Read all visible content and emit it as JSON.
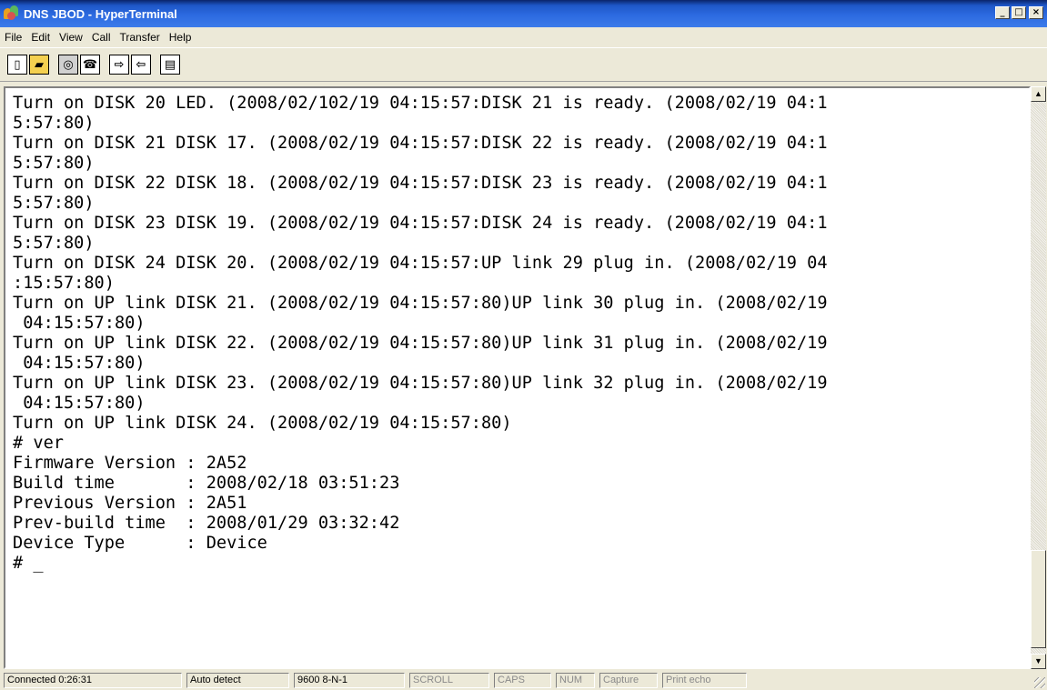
{
  "window": {
    "title": "DNS JBOD - HyperTerminal",
    "minimize_glyph": "_",
    "maximize_glyph": "□",
    "close_glyph": "×"
  },
  "menu": [
    {
      "label": "File"
    },
    {
      "label": "Edit"
    },
    {
      "label": "View"
    },
    {
      "label": "Call"
    },
    {
      "label": "Transfer"
    },
    {
      "label": "Help"
    }
  ],
  "toolbar": {
    "buttons": [
      {
        "icon": "new-connection-icon",
        "glyph": "▯"
      },
      {
        "icon": "open-folder-icon",
        "glyph": "▰"
      },
      {
        "icon": "disconnect-icon",
        "glyph": "◎"
      },
      {
        "icon": "dial-icon",
        "glyph": "☎"
      },
      {
        "icon": "send-file-icon",
        "glyph": "⇨"
      },
      {
        "icon": "receive-file-icon",
        "glyph": "⇦"
      },
      {
        "icon": "properties-icon",
        "glyph": "▤"
      }
    ]
  },
  "terminal": {
    "lines": [
      "Turn on DISK 20 LED. (2008/02/102/19 04:15:57:DISK 21 is ready. (2008/02/19 04:1",
      "5:57:80)",
      "Turn on DISK 21 DISK 17. (2008/02/19 04:15:57:DISK 22 is ready. (2008/02/19 04:1",
      "5:57:80)",
      "Turn on DISK 22 DISK 18. (2008/02/19 04:15:57:DISK 23 is ready. (2008/02/19 04:1",
      "5:57:80)",
      "Turn on DISK 23 DISK 19. (2008/02/19 04:15:57:DISK 24 is ready. (2008/02/19 04:1",
      "5:57:80)",
      "Turn on DISK 24 DISK 20. (2008/02/19 04:15:57:UP link 29 plug in. (2008/02/19 04",
      ":15:57:80)",
      "Turn on UP link DISK 21. (2008/02/19 04:15:57:80)UP link 30 plug in. (2008/02/19",
      " 04:15:57:80)",
      "Turn on UP link DISK 22. (2008/02/19 04:15:57:80)UP link 31 plug in. (2008/02/19",
      " 04:15:57:80)",
      "Turn on UP link DISK 23. (2008/02/19 04:15:57:80)UP link 32 plug in. (2008/02/19",
      " 04:15:57:80)",
      "Turn on UP link DISK 24. (2008/02/19 04:15:57:80)",
      "# ver",
      "Firmware Version : 2A52",
      "Build time       : 2008/02/18 03:51:23",
      "Previous Version : 2A51",
      "Prev-build time  : 2008/01/29 03:32:42",
      "Device Type      : Device",
      "# _"
    ]
  },
  "scrollbar": {
    "up_glyph": "▲",
    "down_glyph": "▼"
  },
  "status": [
    {
      "label": "Connected 0:26:31",
      "dim": false
    },
    {
      "label": "Auto detect",
      "dim": false
    },
    {
      "label": "9600 8-N-1",
      "dim": false
    },
    {
      "label": "SCROLL",
      "dim": true
    },
    {
      "label": "CAPS",
      "dim": true
    },
    {
      "label": "NUM",
      "dim": true
    },
    {
      "label": "Capture",
      "dim": true
    },
    {
      "label": "Print echo",
      "dim": true
    }
  ]
}
